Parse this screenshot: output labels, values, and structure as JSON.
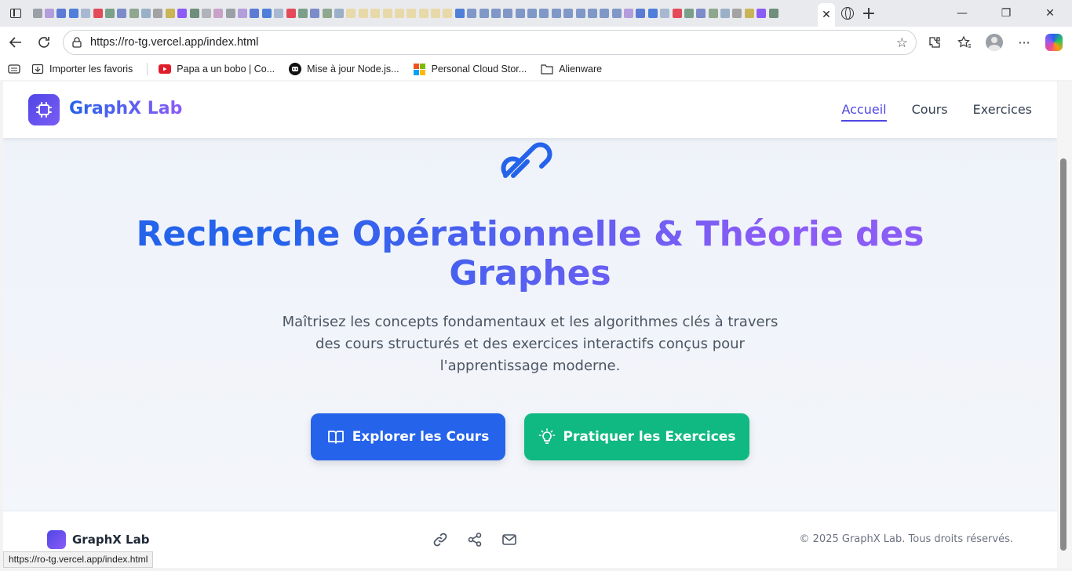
{
  "browser": {
    "url": "https://ro-tg.vercel.app/index.html",
    "bookmarks": [
      {
        "label": "Importer les favoris",
        "icon": "import-favorites-icon"
      },
      {
        "label": "Papa a un bobo | Co...",
        "icon": "youtube-icon"
      },
      {
        "label": "Mise à jour Node.js...",
        "icon": "robot-icon"
      },
      {
        "label": "Personal Cloud Stor...",
        "icon": "microsoft-icon"
      },
      {
        "label": "Alienware",
        "icon": "folder-icon"
      }
    ],
    "status_url": "https://ro-tg.vercel.app/index.html"
  },
  "site": {
    "brand": "GraphX Lab",
    "nav": [
      {
        "label": "Accueil",
        "active": true
      },
      {
        "label": "Cours",
        "active": false
      },
      {
        "label": "Exercices",
        "active": false
      }
    ],
    "hero": {
      "title": "Recherche Opérationnelle & Théorie des Graphes",
      "subtitle": "Maîtrisez les concepts fondamentaux et les algorithmes clés à travers des cours structurés et des exercices interactifs conçus pour l'apprentissage moderne.",
      "primary_button": "Explorer les Cours",
      "secondary_button": "Pratiquer les Exercices"
    },
    "footer": {
      "brand": "GraphX Lab",
      "copyright": "© 2025 GraphX Lab. Tous droits réservés.",
      "icons": [
        "link-icon",
        "share-icon",
        "mail-icon"
      ]
    }
  },
  "colors": {
    "primary": "#2563eb",
    "accent": "#8b5cf6",
    "success": "#10b981"
  }
}
